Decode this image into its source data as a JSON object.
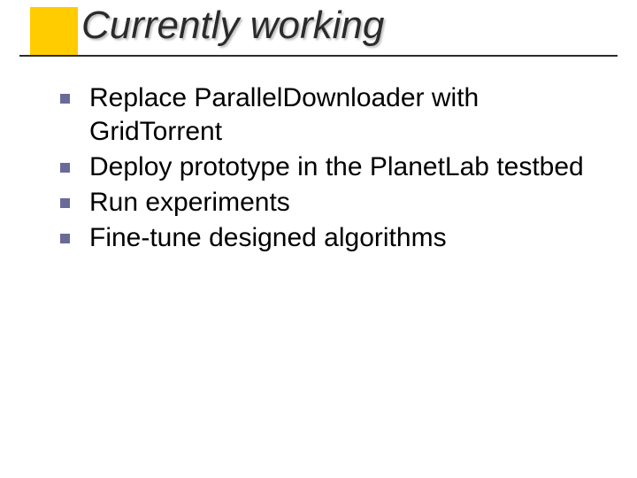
{
  "title": "Currently working",
  "bullets": [
    "Replace ParallelDownloader with GridTorrent",
    "Deploy prototype in the PlanetLab testbed",
    "Run experiments",
    "Fine-tune designed algorithms"
  ],
  "colors": {
    "accent": "#ffcc00",
    "bullet": "#6a6a99",
    "text": "#000000"
  }
}
